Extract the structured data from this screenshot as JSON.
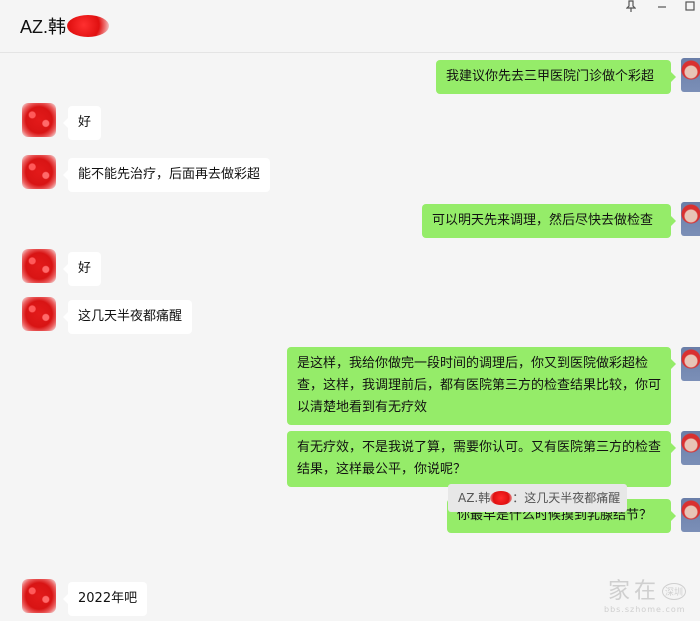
{
  "header": {
    "title": "AZ.韩",
    "pin_icon": "pin-icon",
    "minimize_icon": "minimize-icon",
    "maximize_icon": "maximize-icon"
  },
  "messages": [
    {
      "sender": "me",
      "text": "我建议你先去三甲医院门诊做个彩超"
    },
    {
      "sender": "them",
      "text": "好"
    },
    {
      "sender": "them",
      "text": "能不能先治疗，后面再去做彩超"
    },
    {
      "sender": "me",
      "text": "可以明天先来调理，然后尽快去做检查"
    },
    {
      "sender": "them",
      "text": "好"
    },
    {
      "sender": "them",
      "text": "这几天半夜都痛醒"
    },
    {
      "sender": "me",
      "text": "是这样，我给你做完一段时间的调理后，你又到医院做彩超检查，这样，我调理前后，都有医院第三方的检查结果比较，你可以清楚地看到有无疗效"
    },
    {
      "sender": "me",
      "text": "有无疗效，不是我说了算，需要你认可。又有医院第三方的检查结果，这样最公平，你说呢？"
    },
    {
      "sender": "me",
      "text": "你最早是什么时候摸到乳腺结节？"
    },
    {
      "sender": "them",
      "text": "2022年吧"
    }
  ],
  "quote": {
    "name": "AZ.韩",
    "text": "：这几天半夜都痛醒"
  },
  "watermark": {
    "main": "家在",
    "small": "深圳",
    "url": "bbs.szhome.com"
  },
  "colors": {
    "background": "#f5f5f5",
    "my_bubble": "#95ec69",
    "their_bubble": "#ffffff",
    "quote_bg": "#e7e7e7"
  }
}
